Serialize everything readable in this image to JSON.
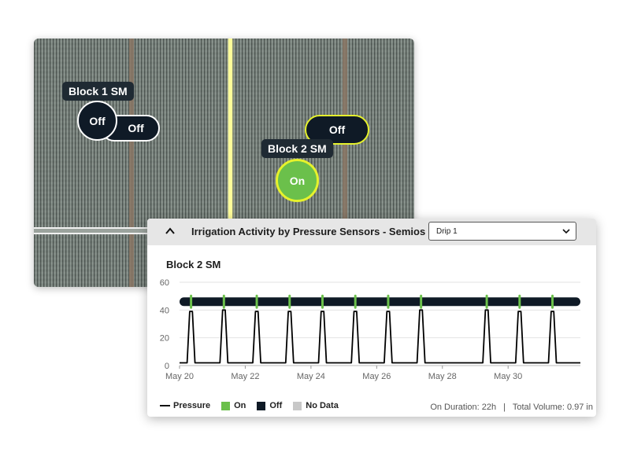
{
  "map": {
    "markers": [
      {
        "label": "Block 1 SM",
        "circle_status": "Off",
        "pill_status": "Off"
      },
      {
        "label": "Block 2 SM",
        "circle_status": "On",
        "pill_status": "Off"
      }
    ]
  },
  "panel": {
    "title": "Irrigation Activity by Pressure Sensors - Semios",
    "select_value": "Drip 1",
    "chart_heading": "Block 2 SM",
    "footer": {
      "on_duration": "On Duration: 22h",
      "separator": "|",
      "total_volume": "Total Volume: 0.97 in"
    }
  },
  "colors": {
    "on": "#6bc04b",
    "off": "#0f1a26",
    "no_data": "#c8c8c8",
    "pressure_line": "#000000",
    "highlight": "#e6f22c"
  },
  "chart_data": {
    "type": "line",
    "y_ticks": [
      0,
      20,
      40,
      60
    ],
    "ylim": [
      0,
      60
    ],
    "x_ticks": [
      "May 20",
      "May 22",
      "May 24",
      "May 26",
      "May 28",
      "May 30"
    ],
    "x_tick_days": [
      20,
      22,
      24,
      26,
      28,
      30
    ],
    "xlim": [
      20,
      32.2
    ],
    "legend": [
      {
        "name": "Pressure",
        "kind": "line",
        "color": "#000000"
      },
      {
        "name": "On",
        "kind": "box",
        "color": "#6bc04b"
      },
      {
        "name": "Off",
        "kind": "box",
        "color": "#0f1a26"
      },
      {
        "name": "No Data",
        "kind": "box",
        "color": "#c8c8c8"
      }
    ],
    "pressure_baseline": 2,
    "pressure_peaks": [
      {
        "day": 20.35,
        "value": 39
      },
      {
        "day": 21.35,
        "value": 40
      },
      {
        "day": 22.35,
        "value": 39
      },
      {
        "day": 23.35,
        "value": 39
      },
      {
        "day": 24.35,
        "value": 39
      },
      {
        "day": 25.35,
        "value": 39
      },
      {
        "day": 26.35,
        "value": 39
      },
      {
        "day": 27.35,
        "value": 40
      },
      {
        "day": 29.35,
        "value": 40
      },
      {
        "day": 30.35,
        "value": 39
      },
      {
        "day": 31.35,
        "value": 39
      }
    ],
    "status_band_value": 46,
    "status_on_days": [
      20.35,
      21.35,
      22.35,
      23.35,
      24.35,
      25.35,
      26.35,
      27.35,
      29.35,
      30.35,
      31.35
    ]
  }
}
